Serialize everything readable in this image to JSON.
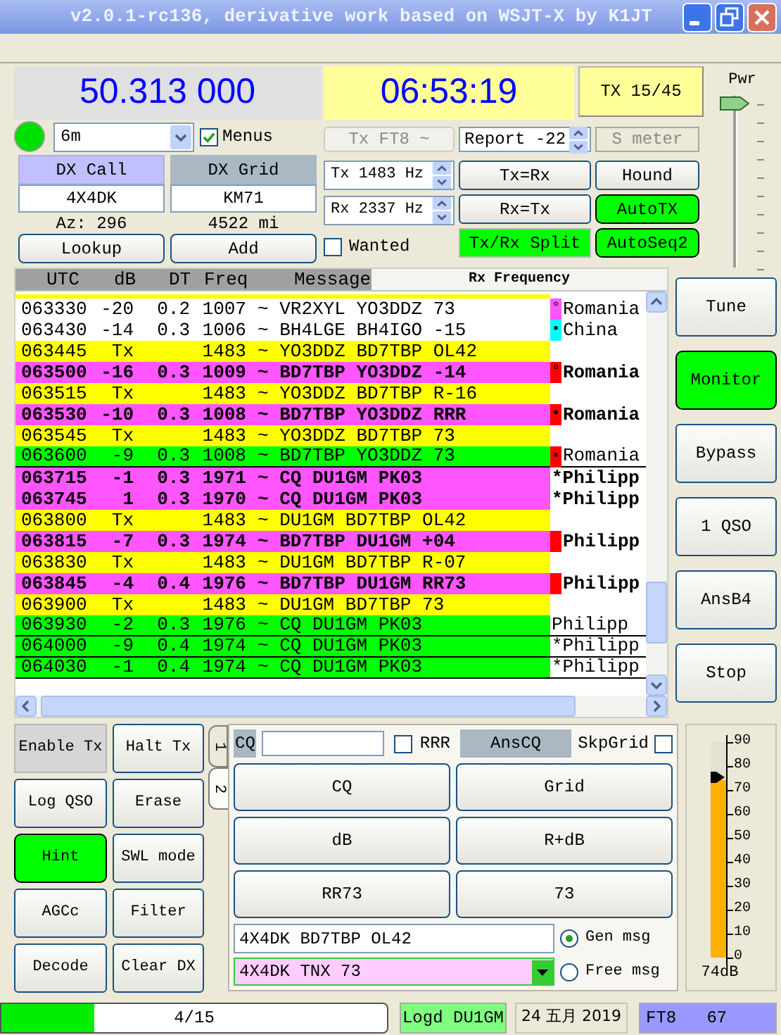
{
  "window": {
    "title": "v2.0.1-rc136, derivative work based on WSJT-X by K1JT"
  },
  "frequency": "50.313 000",
  "clock": "06:53:19",
  "tx_period_button": "TX 15/45",
  "power": {
    "label": "Pwr",
    "level": 1
  },
  "status_light": {
    "on": true
  },
  "band": "6m",
  "menus": {
    "label": "Menus",
    "checked": true
  },
  "mode_button": {
    "label": "Tx FT8 ~",
    "disabled": true
  },
  "report": {
    "label": "Report",
    "value": "-22"
  },
  "s_meter": "S meter",
  "dx_call": {
    "label": "DX Call",
    "value": "4X4DK",
    "info": "Az: 296"
  },
  "dx_grid": {
    "label": "DX Grid",
    "value": "KM71",
    "info": "4522 mi"
  },
  "lookup_buttons": [
    "Lookup",
    "Add"
  ],
  "tx_freq": {
    "label": "Tx",
    "value": "1483",
    "unit": "Hz"
  },
  "rx_freq": {
    "label": "Rx",
    "value": "2337",
    "unit": "Hz"
  },
  "wanted": {
    "label": "Wanted",
    "checked": false
  },
  "control_buttons": [
    {
      "label": "Tx=Rx",
      "on": false,
      "kind": "button"
    },
    {
      "label": "Hound",
      "on": false,
      "kind": "button"
    },
    {
      "label": "Rx=Tx",
      "on": false,
      "kind": "button"
    },
    {
      "label": "AutoTX",
      "on": true,
      "kind": "button"
    },
    {
      "label": "Tx/Rx Split",
      "on": true,
      "kind": "flat"
    },
    {
      "label": "AutoSeq2",
      "on": true,
      "kind": "button"
    }
  ],
  "decodes": {
    "columns": [
      "UTC",
      "dB",
      "DT",
      "Freq",
      "Message"
    ],
    "rx_header": "Rx Frequency",
    "rows": [
      {
        "utc": "063330",
        "db": "-20",
        "dt": "0.2",
        "freq": "1007",
        "message": "~ VR2XYL YO3DDZ 73",
        "kind": "plain",
        "mark": "°",
        "color": "#ff55ff",
        "country": "Romania"
      },
      {
        "utc": "063430",
        "db": "-14",
        "dt": "0.3",
        "freq": "1006",
        "message": "~ BH4LGE BH4IGO -15",
        "kind": "plain",
        "mark": "▪",
        "color": "#00ffff",
        "country": "China"
      },
      {
        "utc": "063445",
        "db": "Tx",
        "freq": "1483",
        "message": "~ YO3DDZ BD7TBP OL42",
        "kind": "tx"
      },
      {
        "utc": "063500",
        "db": "-16",
        "dt": "0.3",
        "freq": "1009",
        "message": "~ BD7TBP YO3DDZ -14",
        "kind": "to_me",
        "mark": "°",
        "color": "#ff0000",
        "country": "Romania"
      },
      {
        "utc": "063515",
        "db": "Tx",
        "freq": "1483",
        "message": "~ YO3DDZ BD7TBP R-16",
        "kind": "tx"
      },
      {
        "utc": "063530",
        "db": "-10",
        "dt": "0.3",
        "freq": "1008",
        "message": "~ BD7TBP YO3DDZ RRR",
        "kind": "to_me",
        "mark": "•",
        "color": "#ff0000",
        "country": "Romania"
      },
      {
        "utc": "063545",
        "db": "Tx",
        "freq": "1483",
        "message": "~ YO3DDZ BD7TBP 73",
        "kind": "tx"
      },
      {
        "utc": "063600",
        "db": "-9",
        "dt": "0.3",
        "freq": "1008",
        "message": "~ BD7TBP YO3DDZ 73",
        "kind": "highlight",
        "mark": "▪",
        "color": "#ff0000",
        "country": "Romania"
      },
      {
        "utc": "063715",
        "db": "-1",
        "dt": "0.3",
        "freq": "1971",
        "message": "~ CQ DU1GM PK03",
        "kind": "to_me",
        "country": "*Philipp"
      },
      {
        "utc": "063745",
        "db": "1",
        "dt": "0.3",
        "freq": "1970",
        "message": "~ CQ DU1GM PK03",
        "kind": "to_me",
        "country": "*Philipp"
      },
      {
        "utc": "063800",
        "db": "Tx",
        "freq": "1483",
        "message": "~ DU1GM BD7TBP OL42",
        "kind": "tx"
      },
      {
        "utc": "063815",
        "db": "-7",
        "dt": "0.3",
        "freq": "1974",
        "message": "~ BD7TBP DU1GM +04",
        "kind": "to_me",
        "color": "#ff0000",
        "country": "Philipp"
      },
      {
        "utc": "063830",
        "db": "Tx",
        "freq": "1483",
        "message": "~ DU1GM BD7TBP R-07",
        "kind": "tx"
      },
      {
        "utc": "063845",
        "db": "-4",
        "dt": "0.4",
        "freq": "1976",
        "message": "~ BD7TBP DU1GM RR73",
        "kind": "to_me",
        "color": "#ff0000",
        "country": "Philipp"
      },
      {
        "utc": "063900",
        "db": "Tx",
        "freq": "1483",
        "message": "~ DU1GM BD7TBP 73",
        "kind": "tx"
      },
      {
        "utc": "063930",
        "db": "-2",
        "dt": "0.3",
        "freq": "1976",
        "message": "~ CQ DU1GM PK03",
        "kind": "highlight",
        "country": "Philipp"
      },
      {
        "utc": "064000",
        "db": "-9",
        "dt": "0.4",
        "freq": "1974",
        "message": "~ CQ DU1GM PK03",
        "kind": "highlight",
        "country": "*Philipp"
      },
      {
        "utc": "064030",
        "db": "-1",
        "dt": "0.4",
        "freq": "1974",
        "message": "~ CQ DU1GM PK03",
        "kind": "highlight",
        "country": "*Philipp"
      }
    ]
  },
  "side_buttons": [
    {
      "label": "Tune",
      "on": false
    },
    {
      "label": "Monitor",
      "on": true
    },
    {
      "label": "Bypass",
      "on": false
    },
    {
      "label": "1 QSO",
      "on": false
    },
    {
      "label": "AnsB4",
      "on": false
    },
    {
      "label": "Stop",
      "on": false
    }
  ],
  "left_buttons": [
    {
      "label": "Enable Tx",
      "on": false,
      "kind": "flat"
    },
    {
      "label": "Halt Tx",
      "on": false,
      "kind": "button"
    },
    {
      "label": "Log QSO",
      "on": false,
      "kind": "button"
    },
    {
      "label": "Erase",
      "on": false,
      "kind": "button"
    },
    {
      "label": "Hint",
      "on": true,
      "kind": "button"
    },
    {
      "label": "SWL mode",
      "on": false,
      "kind": "button"
    },
    {
      "label": "AGCc",
      "on": false,
      "kind": "button"
    },
    {
      "label": "Filter",
      "on": false,
      "kind": "button"
    },
    {
      "label": "Decode",
      "on": false,
      "kind": "button"
    },
    {
      "label": "Clear DX",
      "on": false,
      "kind": "button"
    }
  ],
  "tabs": [
    {
      "label": "1",
      "selected": false
    },
    {
      "label": "2",
      "selected": true
    }
  ],
  "message_panel": {
    "cq_label": "CQ",
    "rrr": {
      "label": "RRR",
      "checked": false
    },
    "ans_cq": "AnsCQ",
    "skip_grid": {
      "label": "SkpGrid",
      "checked": false
    },
    "buttons": [
      "CQ",
      "Grid",
      "dB",
      "R+dB",
      "RR73",
      "73"
    ],
    "gen_field": "4X4DK BD7TBP OL42",
    "free_field": "4X4DK TNX 73",
    "modes": [
      {
        "label": "Gen msg",
        "selected": true
      },
      {
        "label": "Free msg",
        "selected": false
      }
    ]
  },
  "level_meter": {
    "level": 0.822,
    "ticks": [
      "90",
      "80",
      "70",
      "60",
      "50",
      "40",
      "30",
      "20",
      "10",
      "0"
    ],
    "reading": "74dB"
  },
  "status_bar": {
    "progress": {
      "level": 0.24,
      "text": "4/15"
    },
    "logged": "Logd DU1GM",
    "date": "24 五月 2019",
    "mode": "FT8   67"
  }
}
